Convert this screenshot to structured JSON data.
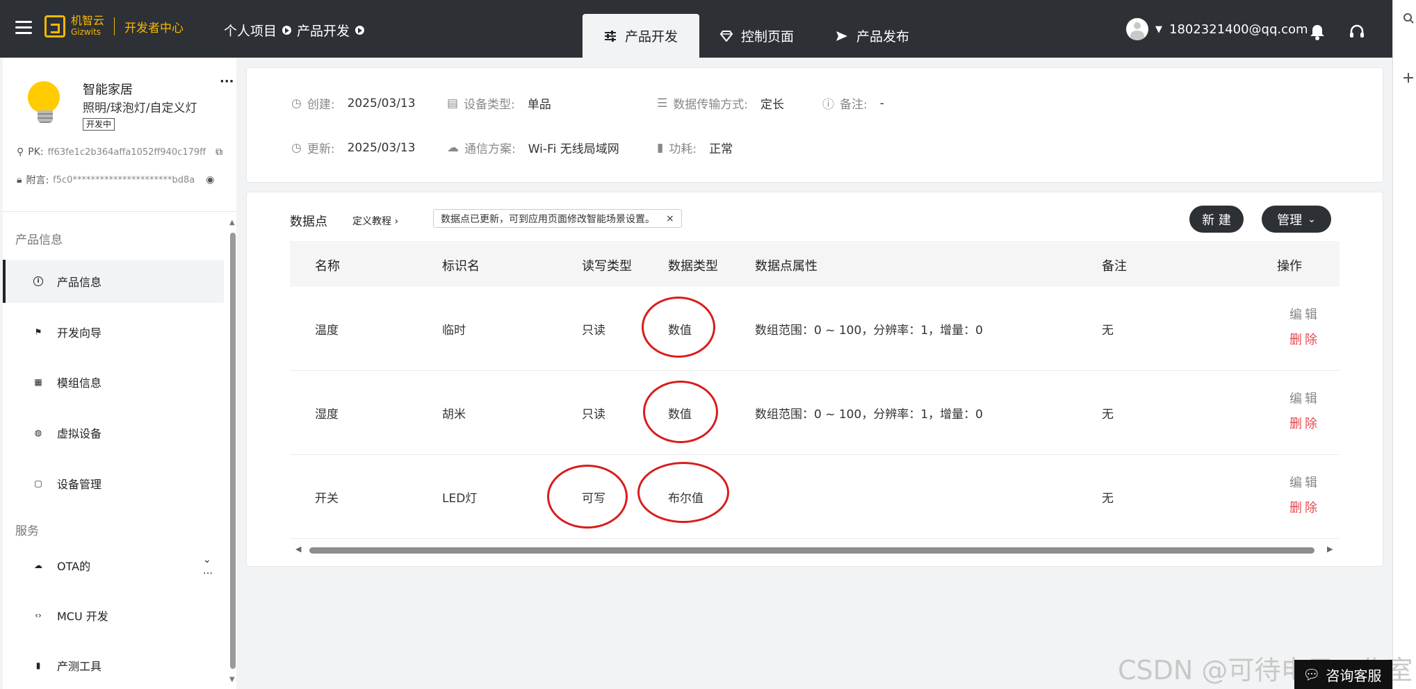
{
  "header": {
    "brand_cn": "机智云",
    "brand_en": "Gizwits",
    "center": "开发者中心",
    "breadcrumb": [
      "个人项目",
      "产品开发"
    ],
    "tabs": [
      {
        "label": "产品开发",
        "active": true,
        "icon": "sliders-icon"
      },
      {
        "label": "控制页面",
        "active": false,
        "icon": "diamond-icon"
      },
      {
        "label": "产品发布",
        "active": false,
        "icon": "send-icon"
      }
    ],
    "user": "1802321400@qq.com"
  },
  "product": {
    "name": "智能家居",
    "category": "照明/球泡灯/自定义灯",
    "status": "开发中",
    "pk_label": "PK:",
    "pk": "ff63fe1c2b364affa1052ff940c179ff",
    "secret_label": "附言:",
    "secret": "f5c0**********************bd8a"
  },
  "sidebar": {
    "section1": "产品信息",
    "items1": [
      {
        "label": "产品信息",
        "icon": "info-icon",
        "active": true
      },
      {
        "label": "开发向导",
        "icon": "signpost-icon",
        "active": false
      },
      {
        "label": "模组信息",
        "icon": "grid-icon",
        "active": false
      },
      {
        "label": "虚拟设备",
        "icon": "globe-icon",
        "active": false
      },
      {
        "label": "设备管理",
        "icon": "clipboard-icon",
        "active": false
      }
    ],
    "section2": "服务",
    "items2": [
      {
        "label": "OTA的",
        "icon": "cloud-icon"
      },
      {
        "label": "MCU 开发",
        "icon": "code-icon"
      },
      {
        "label": "产测工具",
        "icon": "tube-icon"
      }
    ]
  },
  "info": {
    "created_label": "创建:",
    "created": "2025/03/13",
    "updated_label": "更新:",
    "updated": "2025/03/13",
    "devtype_label": "设备类型:",
    "devtype": "单品",
    "comm_label": "通信方案:",
    "comm": "Wi-Fi 无线局域网",
    "trans_label": "数据传输方式:",
    "trans": "定长",
    "power_label": "功耗:",
    "power": "正常",
    "note_label": "备注:",
    "note": "-"
  },
  "datapoints": {
    "title": "数据点",
    "tutorial": "定义教程",
    "notice": "数据点已更新，可到应用页面修改智能场景设置。",
    "new_btn": "新 建",
    "manage_btn": "管理",
    "columns": [
      "名称",
      "标识名",
      "读写类型",
      "数据类型",
      "数据点属性",
      "备注",
      "操作"
    ],
    "rows": [
      {
        "name": "温度",
        "id": "临时",
        "rw": "只读",
        "type": "数值",
        "attr": "数组范围：0 ~ 100，分辨率：1，增量：0",
        "note": "无"
      },
      {
        "name": "湿度",
        "id": "胡米",
        "rw": "只读",
        "type": "数值",
        "attr": "数组范围：0 ~ 100，分辨率：1，增量：0",
        "note": "无"
      },
      {
        "name": "开关",
        "id": "LED灯",
        "rw": "可写",
        "type": "布尔值",
        "attr": "",
        "note": "无"
      }
    ],
    "edit": "编辑",
    "delete": "删除"
  },
  "watermark": "CSDN @可待电子工作室",
  "chat": "咨询客服"
}
